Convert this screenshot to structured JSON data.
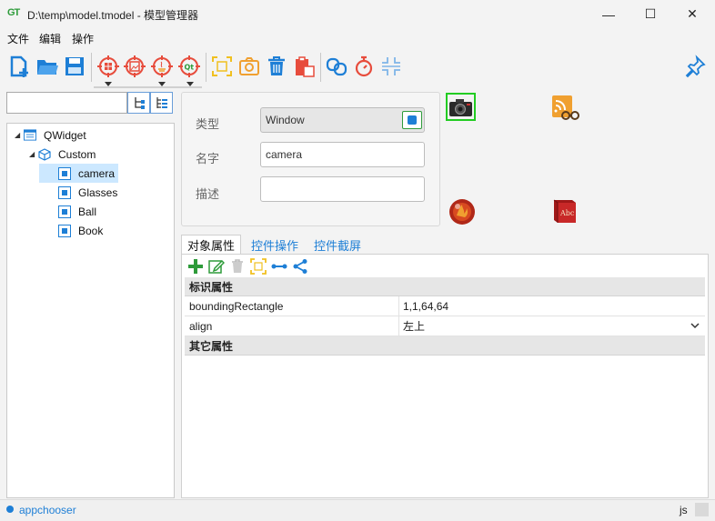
{
  "window": {
    "logo": "GT",
    "title": "D:\\temp\\model.tmodel - 模型管理器",
    "minimize": "—",
    "maximize": "☐",
    "close": "✕"
  },
  "menu": [
    "文件",
    "编辑",
    "操作"
  ],
  "tree": {
    "root": "QWidget",
    "group": "Custom",
    "items": [
      "camera",
      "Glasses",
      "Ball",
      "Book"
    ]
  },
  "form": {
    "type_label": "类型",
    "type_value": "Window",
    "name_label": "名字",
    "name_value": "camera",
    "desc_label": "描述",
    "desc_value": ""
  },
  "tabs": [
    "对象属性",
    "控件操作",
    "控件截屏"
  ],
  "properties": {
    "group1": "标识属性",
    "rows": [
      {
        "name": "boundingRectangle",
        "value": "1,1,64,64"
      },
      {
        "name": "align",
        "value": "左上"
      }
    ],
    "group2": "其它属性"
  },
  "status": {
    "left": "appchooser",
    "right": "js"
  },
  "colors": {
    "accent": "#1e7fd6",
    "selection": "#cce8ff",
    "icon_red": "#e74c3c",
    "icon_orange": "#f0a030",
    "icon_green": "#2e9b3a"
  }
}
